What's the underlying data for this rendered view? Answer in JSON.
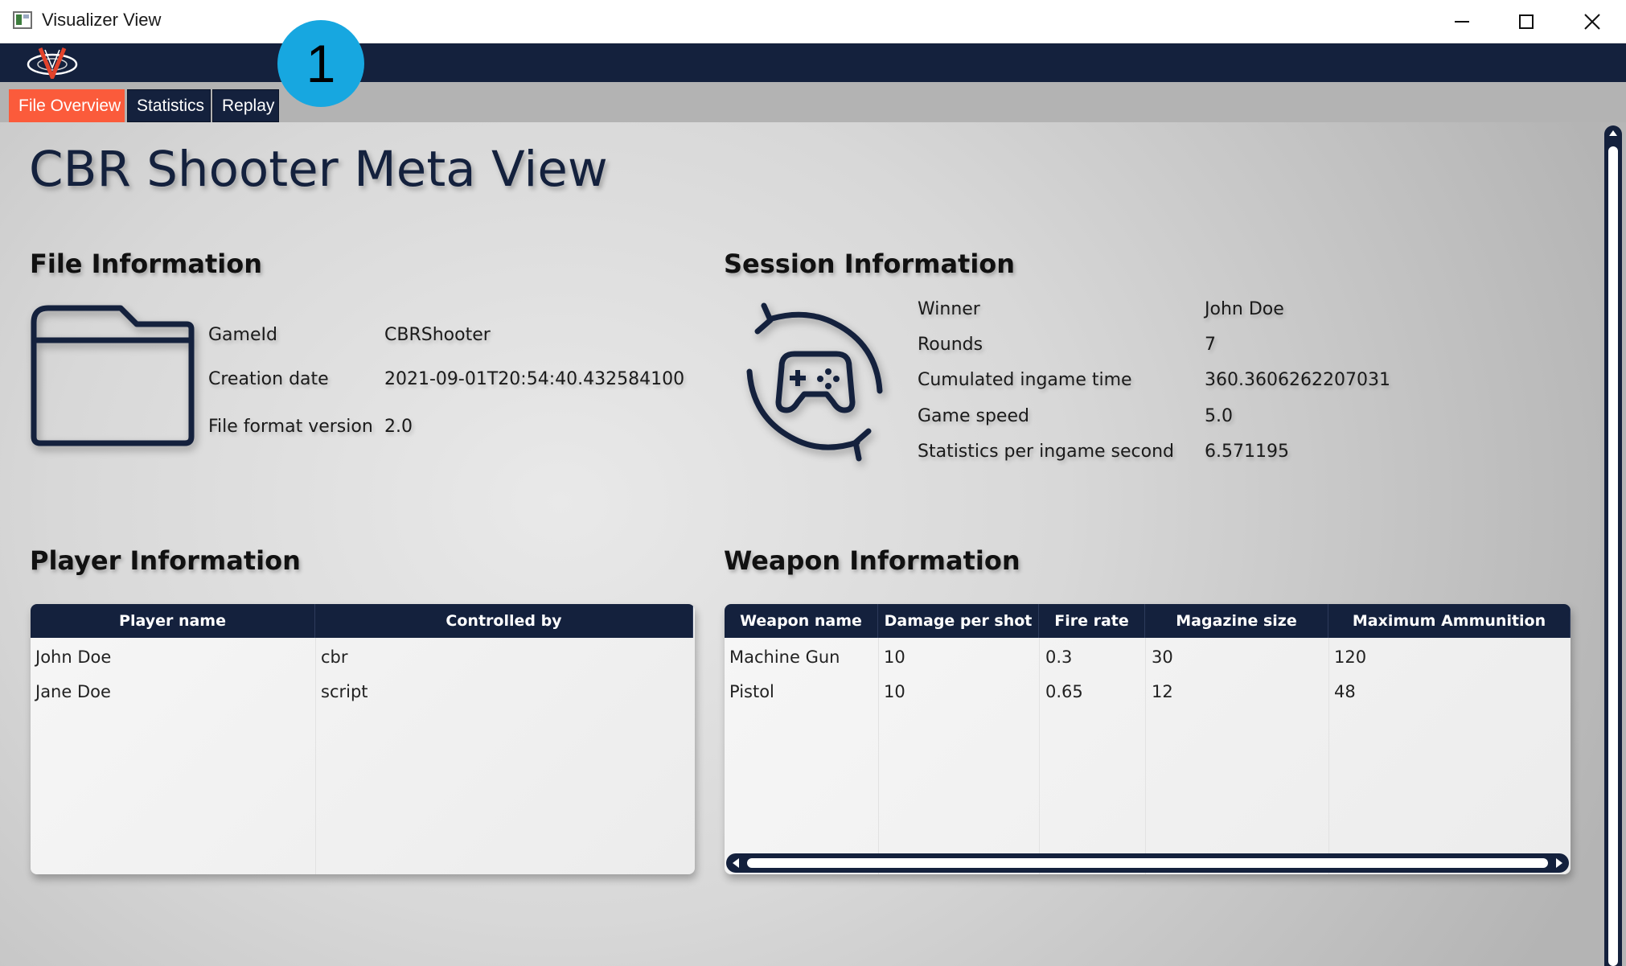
{
  "window": {
    "title": "Visualizer View"
  },
  "tabs": [
    {
      "label": "File Overview",
      "active": true
    },
    {
      "label": "Statistics",
      "active": false
    },
    {
      "label": "Replay",
      "active": false
    }
  ],
  "callout": {
    "label": "1"
  },
  "page": {
    "title": "CBR Shooter Meta View"
  },
  "file_info": {
    "heading": "File Information",
    "rows": [
      {
        "label": "GameId",
        "value": "CBRShooter"
      },
      {
        "label": "Creation date",
        "value": "2021-09-01T20:54:40.432584100"
      },
      {
        "label": "File format version",
        "value": "2.0"
      }
    ]
  },
  "session_info": {
    "heading": "Session Information",
    "rows": [
      {
        "label": "Winner",
        "value": "John Doe"
      },
      {
        "label": "Rounds",
        "value": "7"
      },
      {
        "label": "Cumulated ingame time",
        "value": "360.3606262207031"
      },
      {
        "label": "Game speed",
        "value": "5.0"
      },
      {
        "label": "Statistics per ingame second",
        "value": "6.571195"
      }
    ]
  },
  "player_info": {
    "heading": "Player Information",
    "columns": [
      "Player name",
      "Controlled by"
    ],
    "rows": [
      [
        "John Doe",
        "cbr"
      ],
      [
        "Jane Doe",
        "script"
      ]
    ]
  },
  "weapon_info": {
    "heading": "Weapon Information",
    "columns": [
      "Weapon name",
      "Damage per shot",
      "Fire rate",
      "Magazine size",
      "Maximum Ammunition"
    ],
    "rows": [
      [
        "Machine Gun",
        "10",
        "0.3",
        "30",
        "120"
      ],
      [
        "Pistol",
        "10",
        "0.65",
        "12",
        "48"
      ]
    ]
  },
  "icons": {
    "window": "app-window-icon",
    "minimize": "minimize-icon",
    "maximize": "maximize-icon",
    "close": "close-icon",
    "logo": "visualizer-logo",
    "file": "folder-icon",
    "session": "gamepad-sync-icon"
  },
  "colors": {
    "navy": "#14213d",
    "accent": "#fb5b3b",
    "callout": "#17a7e0"
  }
}
